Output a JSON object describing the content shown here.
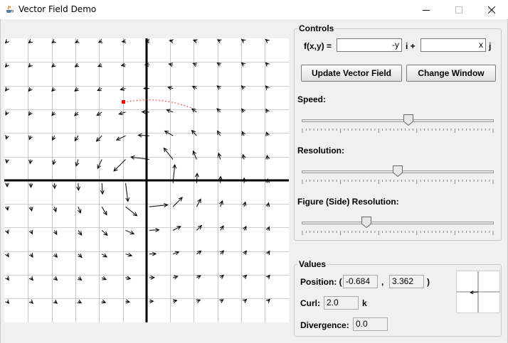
{
  "window": {
    "title": "Vector Field Demo"
  },
  "controls": {
    "legend": "Controls",
    "fxy_label": "f(x,y) =",
    "i_component": "-y",
    "i_label": "i +",
    "j_component": "x",
    "j_label": "j",
    "update_button": "Update Vector Field",
    "change_window_button": "Change Window",
    "speed": {
      "label": "Speed:",
      "value": 0.56
    },
    "resolution": {
      "label": "Resolution:",
      "value": 0.5
    },
    "figure_resolution": {
      "label": "Figure (Side) Resolution:",
      "value": 0.33
    }
  },
  "values": {
    "legend": "Values",
    "position_label": "Position: (",
    "position_x": "-0.684",
    "comma": ",",
    "position_y": "3.362",
    "close_paren": ")",
    "curl_label": "Curl:",
    "curl": "2.0",
    "curl_unit": "k",
    "divergence_label": "Divergence:",
    "divergence": "0.0"
  },
  "colors": {
    "particle": "#ff0000",
    "axes": "#000000",
    "grid": "#a0a0a0"
  },
  "icons": {
    "app": "java-cup-icon",
    "minimize": "minimize-icon",
    "maximize": "maximize-icon",
    "close": "close-icon"
  }
}
